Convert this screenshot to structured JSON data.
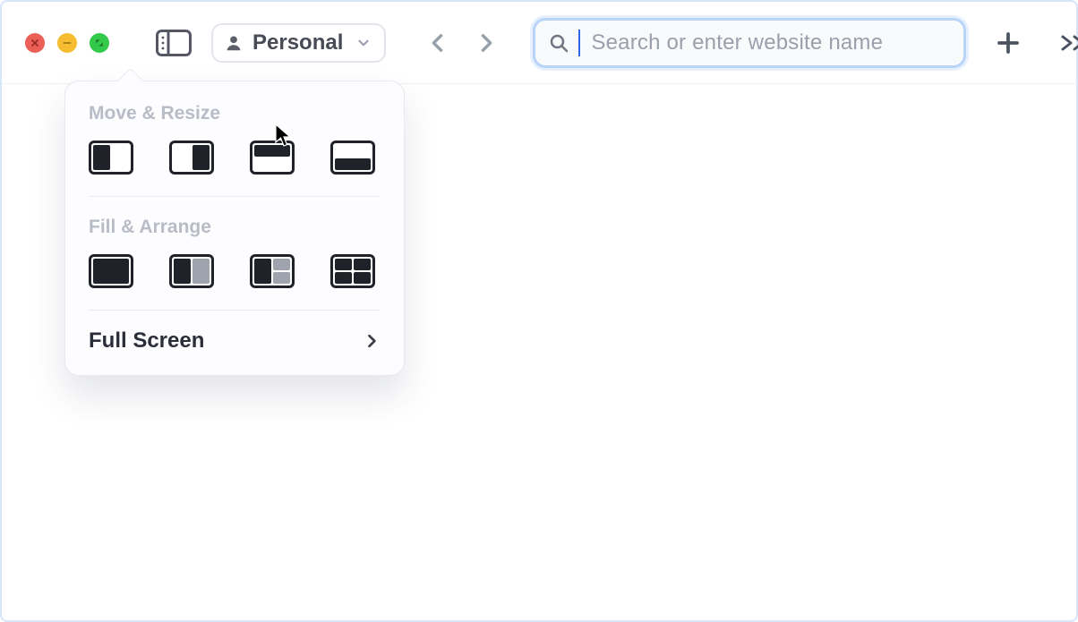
{
  "toolbar": {
    "profile_label": "Personal",
    "search_placeholder": "Search or enter website name"
  },
  "window_menu": {
    "sections": [
      {
        "title": "Move & Resize"
      },
      {
        "title": "Fill & Arrange"
      }
    ],
    "full_screen_label": "Full Screen"
  }
}
